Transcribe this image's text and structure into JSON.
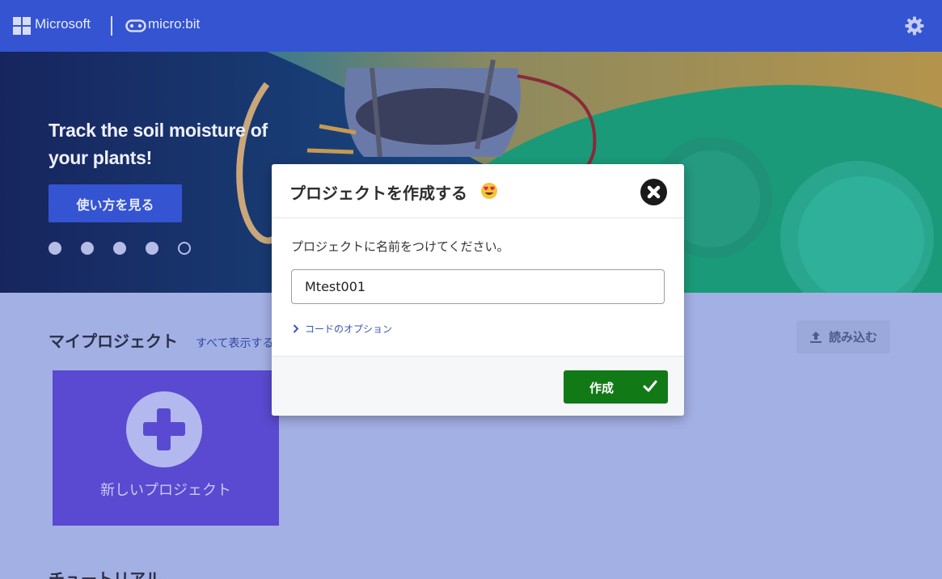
{
  "header": {
    "microsoft_label": "Microsoft",
    "product_label": "micro:bit",
    "settings_icon": "gear-icon"
  },
  "hero": {
    "title": "Track the soil moisture of your plants!",
    "button_label": "使い方を見る",
    "carousel_count": 5,
    "carousel_active_index": 4
  },
  "projects": {
    "title": "マイプロジェクト",
    "see_all_label": "すべて表示する",
    "import_label": "読み込む",
    "new_project_label": "新しいプロジェクト"
  },
  "tutorials": {
    "title": "チュートリアル"
  },
  "dialog": {
    "title": "プロジェクトを作成する",
    "title_emoji": "heart-eyes-emoji",
    "prompt": "プロジェクトに名前をつけてください。",
    "name_value": "Mtest001",
    "code_options_label": "コードのオプション",
    "create_label": "作成",
    "close_icon": "close-icon"
  },
  "colors": {
    "header_bg": "#3454d1",
    "page_bg": "#a3b0e4",
    "new_project_bg": "#5a4ad1",
    "create_button_bg": "#117a17"
  }
}
